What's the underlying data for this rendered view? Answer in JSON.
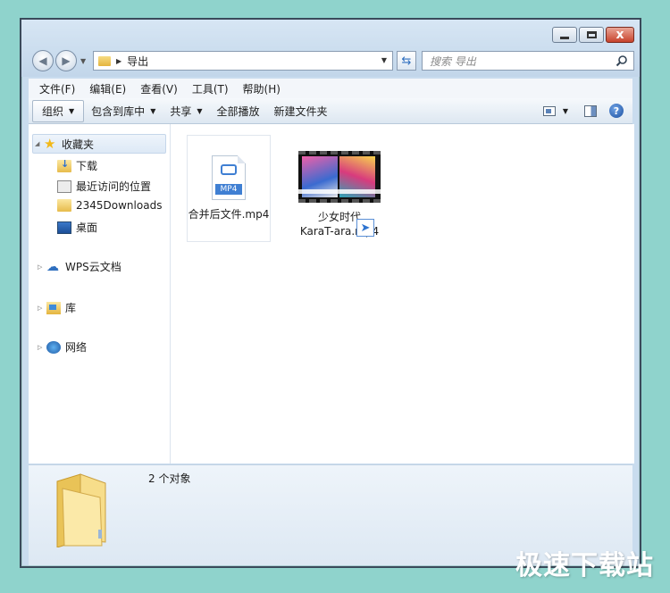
{
  "window": {
    "address_path": "导出",
    "search_placeholder": "搜索 导出",
    "caption_close": "x"
  },
  "menubar": {
    "items": [
      "文件(F)",
      "编辑(E)",
      "查看(V)",
      "工具(T)",
      "帮助(H)"
    ]
  },
  "toolbar": {
    "organize": "组织",
    "include_library": "包含到库中",
    "share": "共享",
    "play_all": "全部播放",
    "new_folder": "新建文件夹",
    "help": "?"
  },
  "nav": {
    "favorites": "收藏夹",
    "downloads": "下载",
    "recent": "最近访问的位置",
    "downloads2345": "2345Downloads",
    "desktop": "桌面",
    "wps": "WPS云文档",
    "library": "库",
    "network": "网络"
  },
  "files": [
    {
      "name": "合并后文件.mp4",
      "icon": "mp4-file-icon",
      "tag": "MP4"
    },
    {
      "name_line1": "少女时代",
      "name_line2": "KaraT-ara.mp4",
      "icon": "video-thumbnail"
    }
  ],
  "details": {
    "count": "2 个对象"
  },
  "watermark": "极速下载站",
  "colors": {
    "accent": "#3f7fd3",
    "background": "#8fd3cc"
  }
}
